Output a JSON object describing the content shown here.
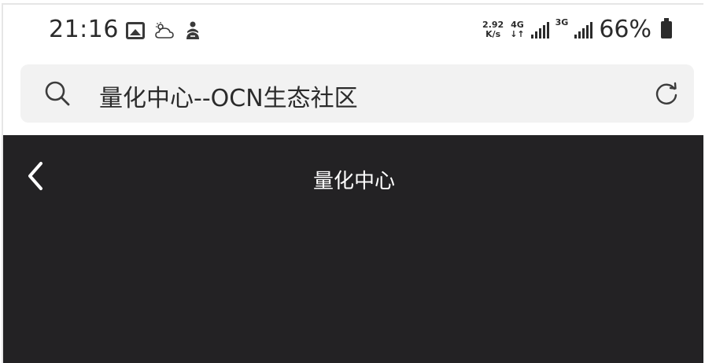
{
  "status_bar": {
    "time": "21:16",
    "net_speed_value": "2.92",
    "net_speed_unit": "K/s",
    "network_type_1": "4G",
    "network_type_2": "3G",
    "battery_percent": "66%",
    "icons": [
      "image-icon",
      "weather-icon",
      "app-notification-icon"
    ]
  },
  "address_bar": {
    "url_text": "量化中心--OCN生态社区",
    "icons": [
      "search-icon",
      "refresh-icon"
    ]
  },
  "header": {
    "title": "量化中心",
    "back_icon": "chevron-left-icon"
  },
  "colors": {
    "header_bg": "#232224",
    "address_bg": "#f2f2f2",
    "text_dark": "#2b2b2b",
    "text_light": "#ffffff"
  }
}
